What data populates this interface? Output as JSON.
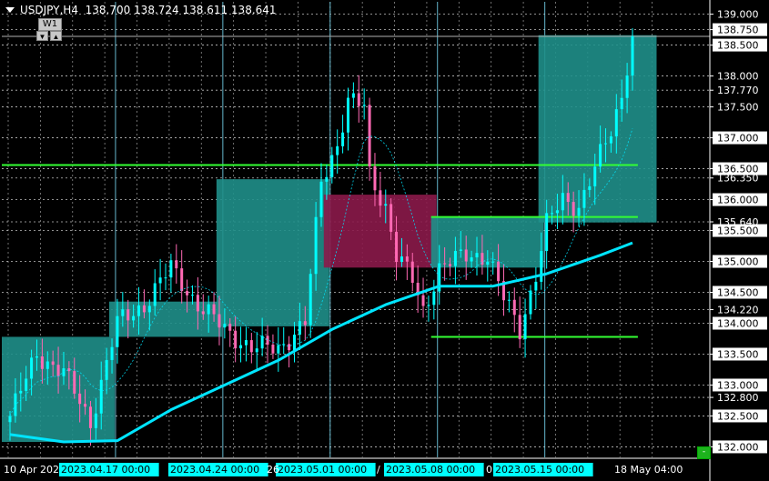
{
  "header": {
    "symbol": "USDJPY,H4",
    "ohlc": "138.700 138.724 138.611 138.641"
  },
  "timeframe_panel": {
    "label": "W1",
    "down_glyph": "▼",
    "up_glyph": "▲"
  },
  "corner_button": {
    "glyph": "-"
  },
  "colors": {
    "background": "#000000",
    "grid": "#ffffff",
    "bull": "#00ffff",
    "bear": "#ff69b4",
    "ma": "#00e5ff",
    "teal_zone": "#1f8f8a",
    "pink_zone": "#8b1a4a",
    "green_line": "#33ff33",
    "current_price_line": "#b0b0b0",
    "time_label_bg": "#00ffff"
  },
  "chart_data": {
    "type": "candlestick",
    "price_axis": {
      "range": [
        131.83,
        139.2
      ],
      "labels": [
        "139.000",
        "138.750",
        "138.500",
        "138.000",
        "137.770",
        "137.500",
        "137.000",
        "136.500",
        "136.350",
        "136.000",
        "135.640",
        "135.500",
        "135.000",
        "134.500",
        "134.220",
        "134.000",
        "133.500",
        "133.000",
        "132.800",
        "132.500",
        "132.000"
      ],
      "highlighted": [
        "138.750",
        "138.500",
        "137.000",
        "136.500",
        "136.000",
        "135.500",
        "135.000",
        "134.500",
        "134.000",
        "133.500",
        "133.000",
        "132.500",
        "132.000"
      ]
    },
    "time_axis": {
      "labels": [
        {
          "text": "10 Apr 202",
          "highlight": false
        },
        {
          "text": "2023.04.17 00:00",
          "highlight": true
        },
        {
          "text": "2023.04.24 00:00",
          "highlight": true
        },
        {
          "text": "2023.05.01 00:00",
          "highlight": true
        },
        {
          "text": "2023.05.08 00:00",
          "highlight": true
        },
        {
          "text": "2023.05.15 00:00",
          "highlight": true
        },
        {
          "text": "18 May 04:00",
          "highlight": false
        }
      ],
      "fragments": [
        "26",
        "/",
        "0"
      ]
    },
    "current_price": 138.641,
    "horizontal_lines": [
      {
        "price": 136.56,
        "from_bar": 0,
        "to_bar": 117,
        "color": "green"
      },
      {
        "price": 135.72,
        "from_bar": 80,
        "to_bar": 117,
        "color": "green"
      },
      {
        "price": 133.78,
        "from_bar": 80,
        "to_bar": 117,
        "color": "green"
      }
    ],
    "zones": [
      {
        "from_bar": 0,
        "to_bar": 19,
        "low": 132.08,
        "high": 133.78,
        "kind": "teal"
      },
      {
        "from_bar": 20,
        "to_bar": 39,
        "low": 133.78,
        "high": 134.35,
        "kind": "teal"
      },
      {
        "from_bar": 40,
        "to_bar": 59,
        "low": 133.95,
        "high": 136.33,
        "kind": "teal"
      },
      {
        "from_bar": 60,
        "to_bar": 79,
        "low": 134.9,
        "high": 136.08,
        "kind": "pink"
      },
      {
        "from_bar": 80,
        "to_bar": 99,
        "low": 134.9,
        "high": 135.72,
        "kind": "teal"
      },
      {
        "from_bar": 100,
        "to_bar": 120,
        "low": 135.63,
        "high": 138.66,
        "kind": "teal"
      }
    ],
    "key_points": [
      {
        "bar": 0,
        "price": 132.5
      },
      {
        "bar": 5,
        "price": 133.5
      },
      {
        "bar": 10,
        "price": 133.2
      },
      {
        "bar": 15,
        "price": 132.4
      },
      {
        "bar": 20,
        "price": 134.0
      },
      {
        "bar": 25,
        "price": 134.3
      },
      {
        "bar": 30,
        "price": 134.9
      },
      {
        "bar": 35,
        "price": 134.3
      },
      {
        "bar": 40,
        "price": 133.9
      },
      {
        "bar": 45,
        "price": 133.6
      },
      {
        "bar": 50,
        "price": 133.6
      },
      {
        "bar": 55,
        "price": 134.0
      },
      {
        "bar": 58,
        "price": 136.3
      },
      {
        "bar": 61,
        "price": 136.9
      },
      {
        "bar": 63,
        "price": 137.6
      },
      {
        "bar": 66,
        "price": 137.5
      },
      {
        "bar": 67,
        "price": 136.4
      },
      {
        "bar": 70,
        "price": 135.9
      },
      {
        "bar": 72,
        "price": 135.1
      },
      {
        "bar": 75,
        "price": 134.7
      },
      {
        "bar": 77,
        "price": 134.2
      },
      {
        "bar": 80,
        "price": 134.9
      },
      {
        "bar": 85,
        "price": 135.1
      },
      {
        "bar": 89,
        "price": 135.1
      },
      {
        "bar": 92,
        "price": 134.4
      },
      {
        "bar": 95,
        "price": 133.9
      },
      {
        "bar": 98,
        "price": 134.8
      },
      {
        "bar": 100,
        "price": 135.6
      },
      {
        "bar": 103,
        "price": 136.0
      },
      {
        "bar": 106,
        "price": 135.9
      },
      {
        "bar": 109,
        "price": 136.5
      },
      {
        "bar": 112,
        "price": 137.1
      },
      {
        "bar": 114,
        "price": 137.7
      },
      {
        "bar": 116,
        "price": 138.7
      }
    ],
    "moving_average": [
      {
        "bar": 0,
        "price": 132.2
      },
      {
        "bar": 10,
        "price": 132.08
      },
      {
        "bar": 20,
        "price": 132.1
      },
      {
        "bar": 30,
        "price": 132.6
      },
      {
        "bar": 40,
        "price": 133.0
      },
      {
        "bar": 50,
        "price": 133.4
      },
      {
        "bar": 60,
        "price": 133.9
      },
      {
        "bar": 70,
        "price": 134.3
      },
      {
        "bar": 80,
        "price": 134.6
      },
      {
        "bar": 90,
        "price": 134.6
      },
      {
        "bar": 100,
        "price": 134.8
      },
      {
        "bar": 110,
        "price": 135.1
      },
      {
        "bar": 116,
        "price": 135.3
      }
    ],
    "bar_count": 117
  }
}
